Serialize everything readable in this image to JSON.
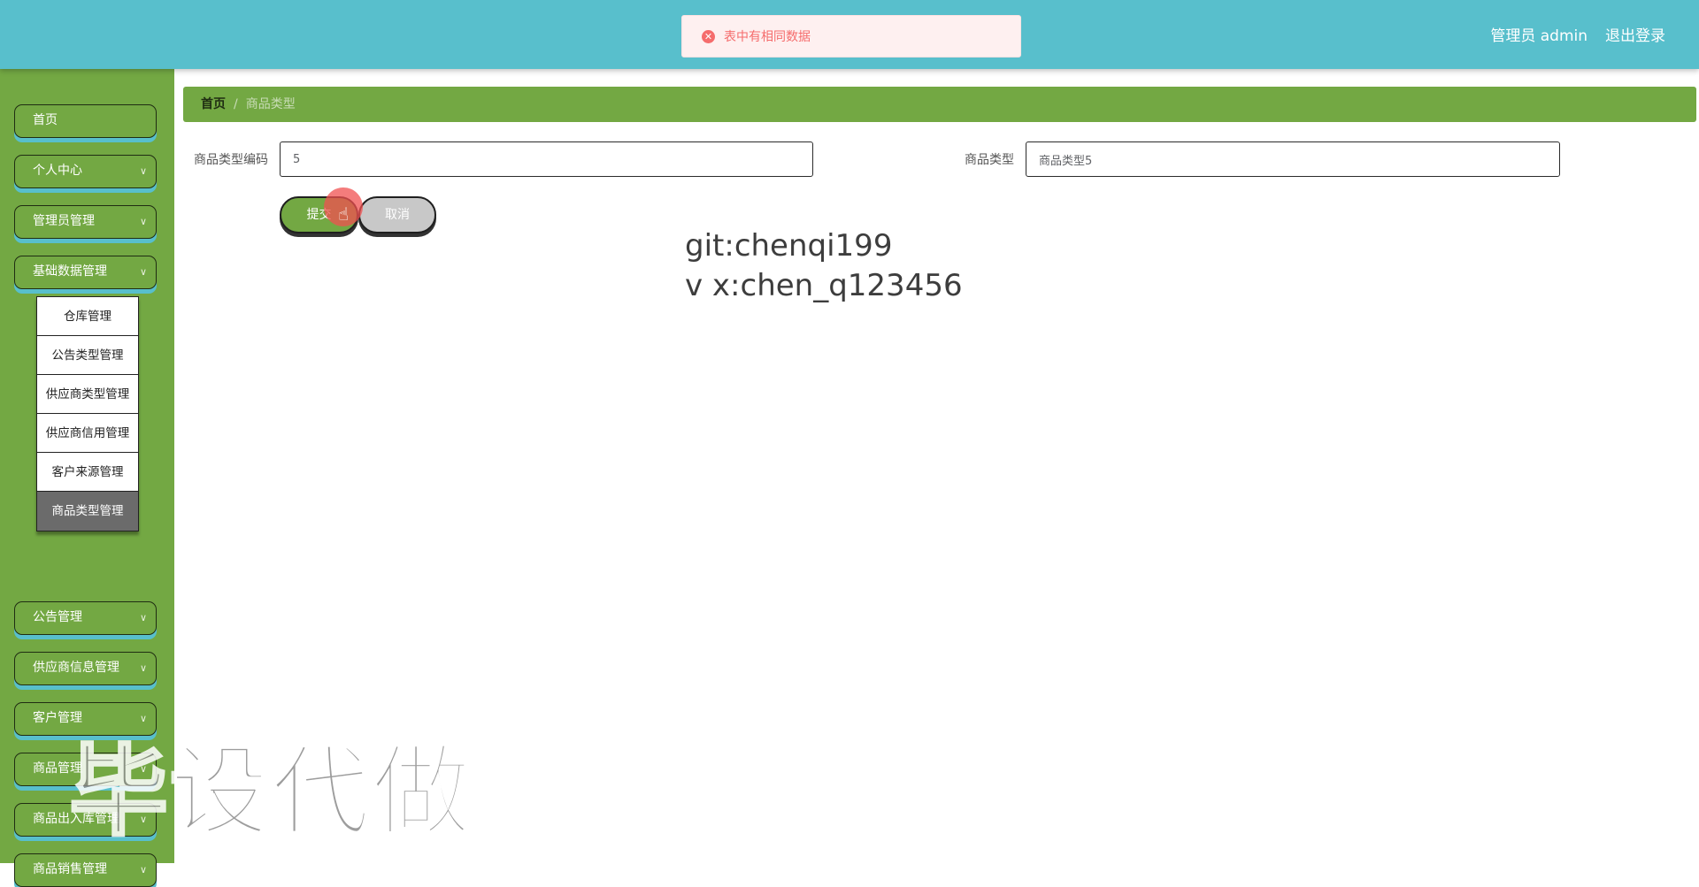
{
  "header": {
    "user_label": "管理员 admin",
    "logout_label": "退出登录"
  },
  "toast": {
    "message": "表中有相同数据",
    "type": "error"
  },
  "sidebar": {
    "items": [
      {
        "label": "首页",
        "has_children": false
      },
      {
        "label": "个人中心",
        "has_children": true
      },
      {
        "label": "管理员管理",
        "has_children": true
      },
      {
        "label": "基础数据管理",
        "has_children": true,
        "expanded": true
      },
      {
        "label": "公告管理",
        "has_children": true
      },
      {
        "label": "供应商信息管理",
        "has_children": true
      },
      {
        "label": "客户管理",
        "has_children": true
      },
      {
        "label": "商品管理",
        "has_children": true
      },
      {
        "label": "商品出入库管理",
        "has_children": true
      },
      {
        "label": "商品销售管理",
        "has_children": true
      }
    ],
    "submenu": [
      {
        "label": "仓库管理"
      },
      {
        "label": "公告类型管理"
      },
      {
        "label": "供应商类型管理"
      },
      {
        "label": "供应商信用管理"
      },
      {
        "label": "客户来源管理"
      },
      {
        "label": "商品类型管理",
        "active": true
      }
    ]
  },
  "breadcrumb": {
    "home": "首页",
    "separator": "/",
    "current": "商品类型"
  },
  "form": {
    "code_label": "商品类型编码",
    "code_value": "5",
    "type_label": "商品类型",
    "type_value": "商品类型5",
    "submit_label": "提交",
    "cancel_label": "取消"
  },
  "overlay": {
    "line1": "git:chenqi199",
    "line2": "v x:chen_q123456"
  },
  "watermark": "毕设代做",
  "colors": {
    "header": "#58bfcc",
    "sidebar": "#73a843",
    "accent_shadow": "#58bfcc",
    "error": "#f56c6c"
  }
}
